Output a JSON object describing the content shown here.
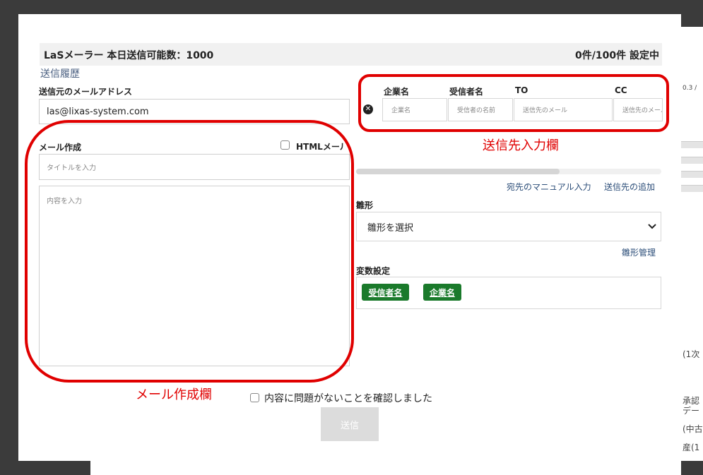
{
  "header": {
    "title": "LaSメーラー 本日送信可能数：1000",
    "status": "0件/100件 設定中",
    "history_link": "送信履歴"
  },
  "sender": {
    "label": "送信元のメールアドレス",
    "value": "las@lixas-system.com"
  },
  "compose": {
    "label": "メール作成",
    "html_label": "HTMLメール",
    "title_placeholder": "タイトルを入力",
    "body_placeholder": "内容を入力"
  },
  "recipients": {
    "columns": [
      "企業名",
      "受信者名",
      "TO",
      "CC"
    ],
    "placeholders": [
      "企業名",
      "受信者の名前",
      "送信先のメール",
      "送信先のメール"
    ]
  },
  "links": {
    "manual_input": "宛先のマニュアル入力",
    "add_recipient": "送信先の追加",
    "template_manage": "雛形管理"
  },
  "template": {
    "label": "雛形",
    "selected": "雛形を選択"
  },
  "variables": {
    "label": "変数設定",
    "tags": [
      "受信者名",
      "企業名"
    ]
  },
  "confirm": {
    "label": "内容に問題がないことを確認しました"
  },
  "send_button": "送信",
  "annotations": {
    "recipient_caption": "送信先入力欄",
    "compose_caption": "メール作成欄"
  },
  "background": {
    "snippets": [
      "0.3 /",
      "(1次",
      "承認",
      "デー",
      "(中古",
      "産(1"
    ]
  },
  "colors": {
    "annotation_red": "#e00000",
    "tag_green": "#1a7a2b",
    "link_blue": "#2b4d78"
  }
}
